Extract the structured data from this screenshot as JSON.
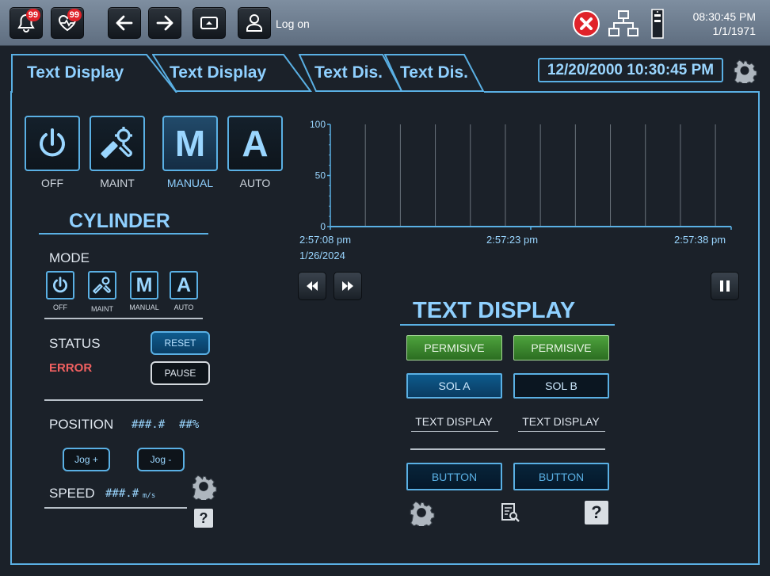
{
  "topbar": {
    "alarm_badge": "99",
    "health_badge": "99",
    "logon_label": "Log on",
    "clock_time": "08:30:45 PM",
    "clock_date": "1/1/1971"
  },
  "tabs": [
    {
      "label": "Text Display"
    },
    {
      "label": "Text Display"
    },
    {
      "label": "Text Dis."
    },
    {
      "label": "Text Dis."
    }
  ],
  "datetime_display": "12/20/2000 10:30:45 PM",
  "mode_buttons": [
    {
      "glyph": "",
      "label": "OFF"
    },
    {
      "glyph": "",
      "label": "MAINT"
    },
    {
      "glyph": "M",
      "label": "MANUAL"
    },
    {
      "glyph": "A",
      "label": "AUTO"
    }
  ],
  "cylinder": {
    "title": "CYLINDER",
    "mode_label": "MODE",
    "mode_buttons": [
      {
        "glyph": "",
        "label": "OFF"
      },
      {
        "glyph": "",
        "label": "MAINT"
      },
      {
        "glyph": "M",
        "label": "MANUAL"
      },
      {
        "glyph": "A",
        "label": "AUTO"
      }
    ],
    "status_label": "STATUS",
    "status_value": "ERROR",
    "reset_label": "RESET",
    "pause_label": "PAUSE",
    "position_label": "POSITION",
    "position_value": "###.#",
    "position_pct": "##%",
    "jog_plus": "Jog +",
    "jog_minus": "Jog -",
    "speed_label": "SPEED",
    "speed_value": "###.#",
    "speed_unit": "m/s"
  },
  "chart_data": {
    "type": "line",
    "title": "",
    "xlabel": "",
    "ylabel": "",
    "ylim": [
      0,
      100
    ],
    "y_ticks": [
      "0",
      "50",
      "100"
    ],
    "x_ticks": [
      "2:57:08 pm",
      "2:57:23 pm",
      "2:57:38 pm"
    ],
    "x_start_date": "1/26/2024",
    "vertical_gridlines": 11,
    "series": []
  },
  "text_display": {
    "title": "TEXT DISPLAY",
    "permisive_1": "PERMISIVE",
    "permisive_2": "PERMISIVE",
    "sol_a": "SOL A",
    "sol_b": "SOL B",
    "text_display_1": "TEXT DISPLAY",
    "text_display_2": "TEXT DISPLAY",
    "button_1": "BUTTON",
    "button_2": "BUTTON"
  },
  "colors": {
    "accent": "#5ab0e4",
    "error": "#f06060",
    "green": "#4ea33d",
    "alarm_red": "#e0232a"
  },
  "icons": [
    "bell-icon",
    "heart-pulse-icon",
    "arrow-left-icon",
    "arrow-right-icon",
    "screen-icon",
    "user-icon",
    "error-x-icon",
    "network-icon",
    "device-icon",
    "gear-icon",
    "power-icon",
    "wrench-icon",
    "help-icon",
    "report-search-icon",
    "rewind-icon",
    "fast-forward-icon",
    "pause-icon"
  ]
}
